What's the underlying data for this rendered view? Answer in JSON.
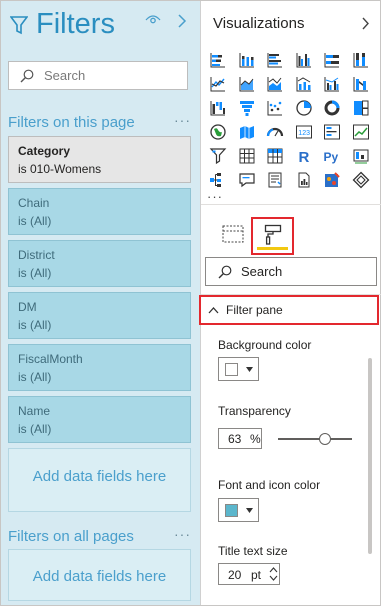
{
  "filters": {
    "title": "Filters",
    "search_placeholder": "Search",
    "page_section_title": "Filters on this page",
    "page_section_more": "···",
    "cards": [
      {
        "name": "Category",
        "value": "is 010-Womens"
      },
      {
        "name": "Chain",
        "value": "is (All)"
      },
      {
        "name": "District",
        "value": "is (All)"
      },
      {
        "name": "DM",
        "value": "is (All)"
      },
      {
        "name": "FiscalMonth",
        "value": "is (All)"
      },
      {
        "name": "Name",
        "value": "is (All)"
      }
    ],
    "add_fields_label": "Add data fields here",
    "all_pages_title": "Filters on all pages",
    "all_pages_more": "···",
    "all_pages_add_label": "Add data fields here"
  },
  "visualizations": {
    "title": "Visualizations",
    "more": "···",
    "search_placeholder": "Search",
    "section_label": "Filter pane",
    "background_color_label": "Background color",
    "transparency_label": "Transparency",
    "transparency_value": "63",
    "transparency_unit": "%",
    "transparency_level_percent": 63,
    "font_icon_color_label": "Font and icon color",
    "font_icon_color": "#5bb6cc",
    "background_color": "#ffffff",
    "title_text_size_label": "Title text size",
    "title_text_size_value": "20",
    "title_text_size_unit": "pt",
    "icons": [
      [
        "stacked-bar-chart-icon",
        "stacked-column-chart-icon",
        "clustered-bar-chart-icon",
        "clustered-column-chart-icon",
        "100-stacked-bar-chart-icon",
        "100-stacked-column-chart-icon"
      ],
      [
        "line-chart-icon",
        "area-chart-icon",
        "stacked-area-chart-icon",
        "line-and-stacked-column-chart-icon",
        "line-and-clustered-column-chart-icon",
        "ribbon-chart-icon"
      ],
      [
        "waterfall-chart-icon",
        "funnel-chart-icon",
        "scatter-chart-icon",
        "pie-chart-icon",
        "donut-chart-icon",
        "treemap-icon"
      ],
      [
        "map-icon",
        "filled-map-icon",
        "gauge-icon",
        "card-icon",
        "multi-row-card-icon",
        "kpi-icon"
      ],
      [
        "slicer-icon",
        "table-icon",
        "matrix-icon",
        "r-visual-icon",
        "python-visual-icon",
        "key-influencers-icon"
      ],
      [
        "decomposition-tree-icon",
        "qa-icon",
        "smart-narrative-icon",
        "paginated-report-icon",
        "arcgis-map-icon",
        "power-apps-icon"
      ]
    ]
  },
  "colors": {
    "filters_bg": "#d6eaf2",
    "card_bg": "#a8d8e6",
    "accent_blue": "#2a8ec0",
    "highlight_red": "#e3282e",
    "format_underline": "#f2c811"
  }
}
